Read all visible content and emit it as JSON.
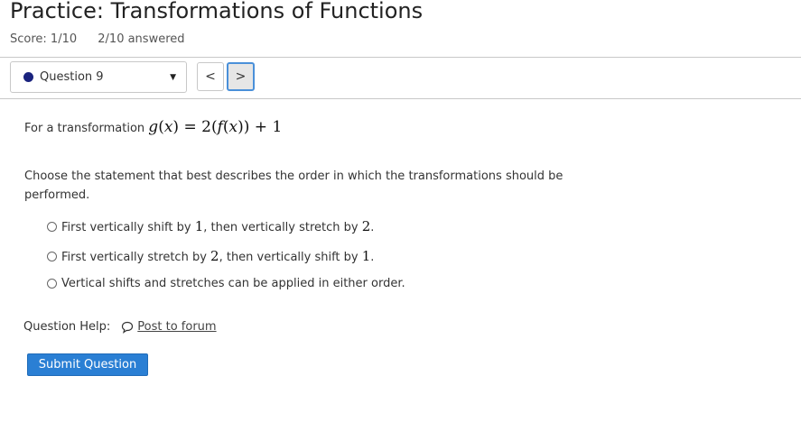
{
  "page": {
    "title": "Practice: Transformations of Functions",
    "score": "Score: 1/10",
    "answered": "2/10 answered"
  },
  "nav": {
    "question_label": "Question 9",
    "prev_symbol": "<",
    "next_symbol": ">",
    "dot_color": "#1a237e",
    "next_border_color": "#4a90d9"
  },
  "question": {
    "intro": "For a transformation",
    "equation": {
      "lhs_func": "g",
      "lhs_var": "x",
      "rhs_factor": "2",
      "inner_func": "f",
      "inner_var": "x",
      "rhs_add": "1"
    },
    "prompt": "Choose the statement that best describes the order in which the transformations should be performed.",
    "choices": [
      {
        "pre": "First vertically shift by ",
        "n1": "1",
        "mid": ", then vertically stretch by ",
        "n2": "2",
        "post": "."
      },
      {
        "pre": "First vertically stretch by ",
        "n1": "2",
        "mid": ", then vertically shift by ",
        "n2": "1",
        "post": "."
      },
      {
        "text": "Vertical shifts and stretches can be applied in either order."
      }
    ]
  },
  "help": {
    "label": "Question Help:",
    "link": "Post to forum",
    "icon": "chat-bubble-icon"
  },
  "submit": {
    "label": "Submit Question",
    "color": "#2a7fd4"
  }
}
